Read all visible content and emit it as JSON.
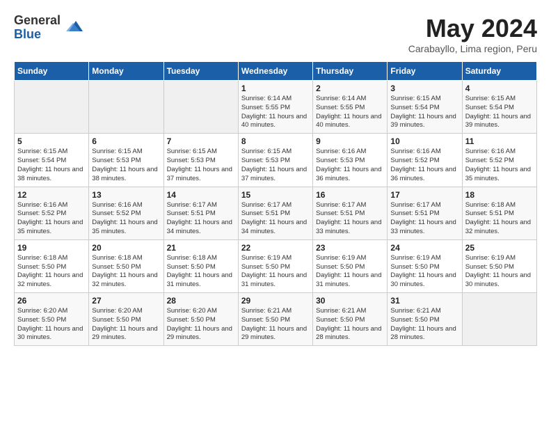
{
  "logo": {
    "general": "General",
    "blue": "Blue"
  },
  "title": "May 2024",
  "subtitle": "Carabayllo, Lima region, Peru",
  "headers": [
    "Sunday",
    "Monday",
    "Tuesday",
    "Wednesday",
    "Thursday",
    "Friday",
    "Saturday"
  ],
  "weeks": [
    [
      {
        "day": "",
        "sunrise": "",
        "sunset": "",
        "daylight": ""
      },
      {
        "day": "",
        "sunrise": "",
        "sunset": "",
        "daylight": ""
      },
      {
        "day": "",
        "sunrise": "",
        "sunset": "",
        "daylight": ""
      },
      {
        "day": "1",
        "sunrise": "Sunrise: 6:14 AM",
        "sunset": "Sunset: 5:55 PM",
        "daylight": "Daylight: 11 hours and 40 minutes."
      },
      {
        "day": "2",
        "sunrise": "Sunrise: 6:14 AM",
        "sunset": "Sunset: 5:55 PM",
        "daylight": "Daylight: 11 hours and 40 minutes."
      },
      {
        "day": "3",
        "sunrise": "Sunrise: 6:15 AM",
        "sunset": "Sunset: 5:54 PM",
        "daylight": "Daylight: 11 hours and 39 minutes."
      },
      {
        "day": "4",
        "sunrise": "Sunrise: 6:15 AM",
        "sunset": "Sunset: 5:54 PM",
        "daylight": "Daylight: 11 hours and 39 minutes."
      }
    ],
    [
      {
        "day": "5",
        "sunrise": "Sunrise: 6:15 AM",
        "sunset": "Sunset: 5:54 PM",
        "daylight": "Daylight: 11 hours and 38 minutes."
      },
      {
        "day": "6",
        "sunrise": "Sunrise: 6:15 AM",
        "sunset": "Sunset: 5:53 PM",
        "daylight": "Daylight: 11 hours and 38 minutes."
      },
      {
        "day": "7",
        "sunrise": "Sunrise: 6:15 AM",
        "sunset": "Sunset: 5:53 PM",
        "daylight": "Daylight: 11 hours and 37 minutes."
      },
      {
        "day": "8",
        "sunrise": "Sunrise: 6:15 AM",
        "sunset": "Sunset: 5:53 PM",
        "daylight": "Daylight: 11 hours and 37 minutes."
      },
      {
        "day": "9",
        "sunrise": "Sunrise: 6:16 AM",
        "sunset": "Sunset: 5:53 PM",
        "daylight": "Daylight: 11 hours and 36 minutes."
      },
      {
        "day": "10",
        "sunrise": "Sunrise: 6:16 AM",
        "sunset": "Sunset: 5:52 PM",
        "daylight": "Daylight: 11 hours and 36 minutes."
      },
      {
        "day": "11",
        "sunrise": "Sunrise: 6:16 AM",
        "sunset": "Sunset: 5:52 PM",
        "daylight": "Daylight: 11 hours and 35 minutes."
      }
    ],
    [
      {
        "day": "12",
        "sunrise": "Sunrise: 6:16 AM",
        "sunset": "Sunset: 5:52 PM",
        "daylight": "Daylight: 11 hours and 35 minutes."
      },
      {
        "day": "13",
        "sunrise": "Sunrise: 6:16 AM",
        "sunset": "Sunset: 5:52 PM",
        "daylight": "Daylight: 11 hours and 35 minutes."
      },
      {
        "day": "14",
        "sunrise": "Sunrise: 6:17 AM",
        "sunset": "Sunset: 5:51 PM",
        "daylight": "Daylight: 11 hours and 34 minutes."
      },
      {
        "day": "15",
        "sunrise": "Sunrise: 6:17 AM",
        "sunset": "Sunset: 5:51 PM",
        "daylight": "Daylight: 11 hours and 34 minutes."
      },
      {
        "day": "16",
        "sunrise": "Sunrise: 6:17 AM",
        "sunset": "Sunset: 5:51 PM",
        "daylight": "Daylight: 11 hours and 33 minutes."
      },
      {
        "day": "17",
        "sunrise": "Sunrise: 6:17 AM",
        "sunset": "Sunset: 5:51 PM",
        "daylight": "Daylight: 11 hours and 33 minutes."
      },
      {
        "day": "18",
        "sunrise": "Sunrise: 6:18 AM",
        "sunset": "Sunset: 5:51 PM",
        "daylight": "Daylight: 11 hours and 32 minutes."
      }
    ],
    [
      {
        "day": "19",
        "sunrise": "Sunrise: 6:18 AM",
        "sunset": "Sunset: 5:50 PM",
        "daylight": "Daylight: 11 hours and 32 minutes."
      },
      {
        "day": "20",
        "sunrise": "Sunrise: 6:18 AM",
        "sunset": "Sunset: 5:50 PM",
        "daylight": "Daylight: 11 hours and 32 minutes."
      },
      {
        "day": "21",
        "sunrise": "Sunrise: 6:18 AM",
        "sunset": "Sunset: 5:50 PM",
        "daylight": "Daylight: 11 hours and 31 minutes."
      },
      {
        "day": "22",
        "sunrise": "Sunrise: 6:19 AM",
        "sunset": "Sunset: 5:50 PM",
        "daylight": "Daylight: 11 hours and 31 minutes."
      },
      {
        "day": "23",
        "sunrise": "Sunrise: 6:19 AM",
        "sunset": "Sunset: 5:50 PM",
        "daylight": "Daylight: 11 hours and 31 minutes."
      },
      {
        "day": "24",
        "sunrise": "Sunrise: 6:19 AM",
        "sunset": "Sunset: 5:50 PM",
        "daylight": "Daylight: 11 hours and 30 minutes."
      },
      {
        "day": "25",
        "sunrise": "Sunrise: 6:19 AM",
        "sunset": "Sunset: 5:50 PM",
        "daylight": "Daylight: 11 hours and 30 minutes."
      }
    ],
    [
      {
        "day": "26",
        "sunrise": "Sunrise: 6:20 AM",
        "sunset": "Sunset: 5:50 PM",
        "daylight": "Daylight: 11 hours and 30 minutes."
      },
      {
        "day": "27",
        "sunrise": "Sunrise: 6:20 AM",
        "sunset": "Sunset: 5:50 PM",
        "daylight": "Daylight: 11 hours and 29 minutes."
      },
      {
        "day": "28",
        "sunrise": "Sunrise: 6:20 AM",
        "sunset": "Sunset: 5:50 PM",
        "daylight": "Daylight: 11 hours and 29 minutes."
      },
      {
        "day": "29",
        "sunrise": "Sunrise: 6:21 AM",
        "sunset": "Sunset: 5:50 PM",
        "daylight": "Daylight: 11 hours and 29 minutes."
      },
      {
        "day": "30",
        "sunrise": "Sunrise: 6:21 AM",
        "sunset": "Sunset: 5:50 PM",
        "daylight": "Daylight: 11 hours and 28 minutes."
      },
      {
        "day": "31",
        "sunrise": "Sunrise: 6:21 AM",
        "sunset": "Sunset: 5:50 PM",
        "daylight": "Daylight: 11 hours and 28 minutes."
      },
      {
        "day": "",
        "sunrise": "",
        "sunset": "",
        "daylight": ""
      }
    ]
  ]
}
